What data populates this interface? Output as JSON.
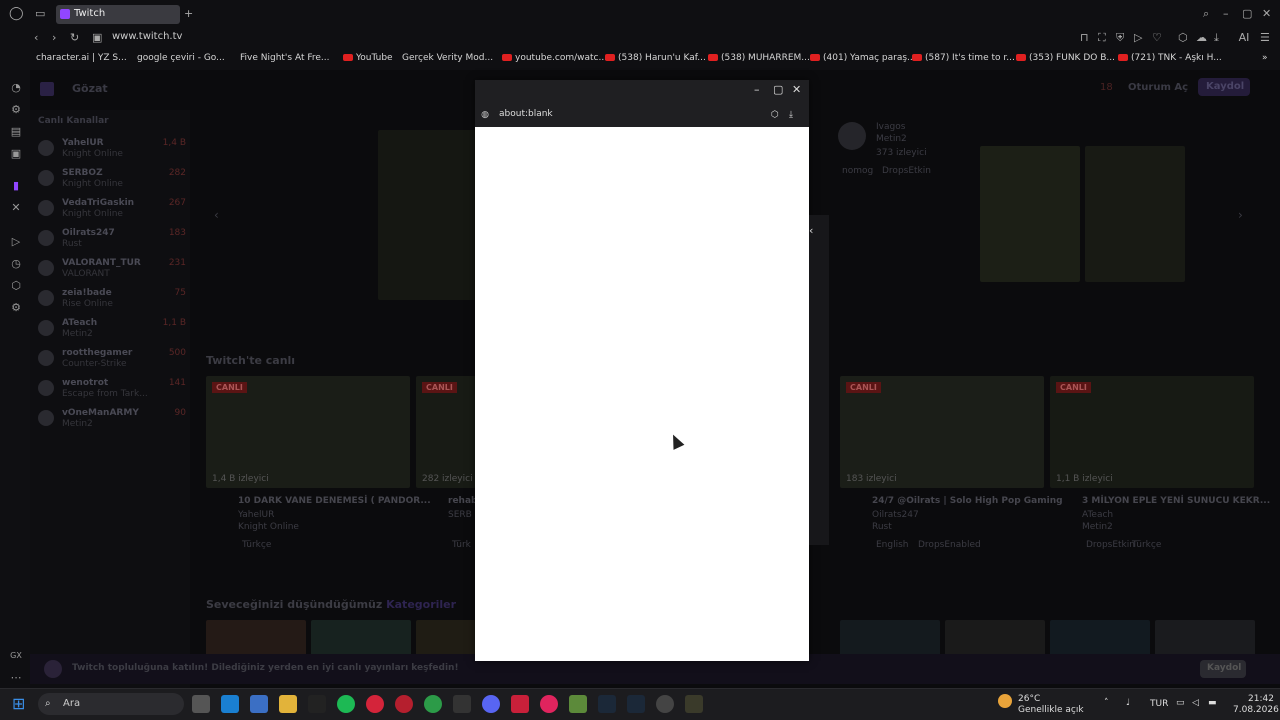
{
  "browser": {
    "tab": {
      "title": "Twitch"
    },
    "url": "www.twitch.tv",
    "bookmarks": [
      {
        "label": "character.ai | YZ S..."
      },
      {
        "label": "google çeviri - Go..."
      },
      {
        "label": "Five Night's At Fre..."
      },
      {
        "label": "YouTube"
      },
      {
        "label": "Gerçek Verity Mod..."
      },
      {
        "label": "youtube.com/watc..."
      },
      {
        "label": "(538) Harun'u Kaf..."
      },
      {
        "label": "(538) MUHARREM..."
      },
      {
        "label": "(401) Yamaç paraş..."
      },
      {
        "label": "(587) It's time to r..."
      },
      {
        "label": "(353) FUNK DO B..."
      },
      {
        "label": "(721) TNK - Aşkı H..."
      }
    ],
    "ai_label": "AI",
    "gx_label": "GX"
  },
  "twitch": {
    "browse": "Gözat",
    "login": "Oturum Aç",
    "signup": "Kaydol",
    "notif_count": "18",
    "side_title": "Canlı Kanallar",
    "channels": [
      {
        "name": "YahelUR",
        "game": "Knight Online",
        "viewers": "1,4 B"
      },
      {
        "name": "SERBOZ",
        "game": "Knight Online",
        "viewers": "282"
      },
      {
        "name": "VedaTriGaskin",
        "game": "Knight Online",
        "viewers": "267"
      },
      {
        "name": "Oilrats247",
        "game": "Rust",
        "viewers": "183"
      },
      {
        "name": "VALORANT_TUR",
        "game": "VALORANT",
        "viewers": "231"
      },
      {
        "name": "zeia!bade",
        "game": "Rise Online",
        "viewers": "75"
      },
      {
        "name": "ATeach",
        "game": "Metin2",
        "viewers": "1,1 B"
      },
      {
        "name": "rootthegamer",
        "game": "Counter-Strike",
        "viewers": "500"
      },
      {
        "name": "wenotrot",
        "game": "Escape from Tark...",
        "viewers": "141"
      },
      {
        "name": "vOneManARMY",
        "game": "Metin2",
        "viewers": "90"
      }
    ],
    "featured": {
      "name": "Ivagos",
      "game": "Metin2",
      "viewers": "373 izleyici",
      "tags": [
        "nomog",
        "DropsEtkin"
      ]
    },
    "section_live": "Twitch'te canlı",
    "live_badge": "CANLI",
    "cards": [
      {
        "viewers": "1,4 B izleyici",
        "title": "10 DARK VANE DENEMESİ ( PANDOR...",
        "channel": "YahelUR",
        "game": "Knight Online",
        "tag": "Türkçe"
      },
      {
        "viewers": "282 izleyici",
        "title": "rehab",
        "channel": "SERB",
        "game": "",
        "tag": "Türk"
      },
      {
        "viewers": "183 izleyici",
        "title": "24/7 @Oilrats | Solo High Pop Gaming",
        "channel": "Oilrats247",
        "game": "Rust",
        "tag": "English"
      },
      {
        "viewers": "1,1 B izleyici",
        "title": "3 MİLYON EPLE YENİ SUNUCU KEKR...",
        "channel": "ATeach",
        "game": "Metin2",
        "tag": "DropsEtkin"
      }
    ],
    "card_tag2": [
      "",
      "",
      "DropsEnabled",
      "Türkçe"
    ],
    "section_cats_prefix": "Seveceğinizi düşündüğümüz",
    "section_cats_link": "Kategoriler",
    "footer_text": "Twitch topluluğuna katılın! Dilediğiniz yerden en iyi canlı yayınları keşfedin!",
    "footer_btn": "Kaydol"
  },
  "popup": {
    "address": "about:blank"
  },
  "taskbar": {
    "search": "Ara",
    "weather_temp": "26°C",
    "weather_text": "Genellikle açık",
    "lang": "TUR",
    "time": "21:42",
    "date": "7.08.2026"
  }
}
